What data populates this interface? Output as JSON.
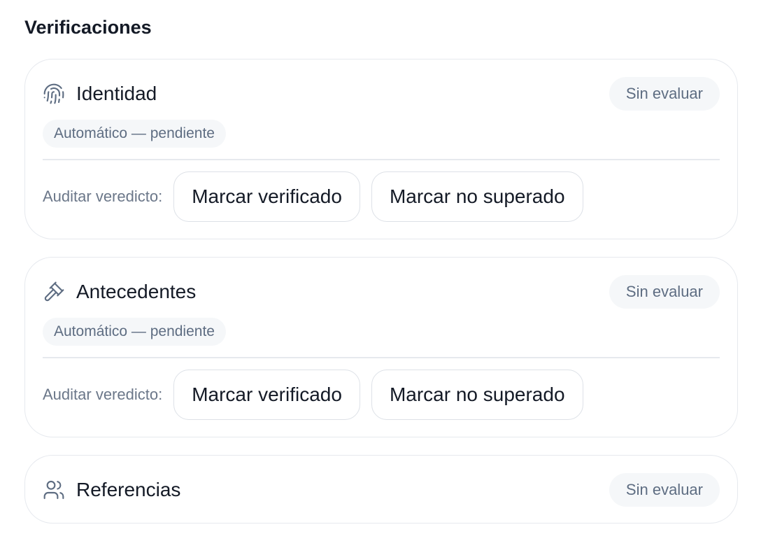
{
  "section": {
    "title": "Verificaciones"
  },
  "checks": [
    {
      "title": "Identidad",
      "icon": "fingerprint-icon",
      "status": "Sin evaluar",
      "method": "Automático — pendiente",
      "audit_label": "Auditar veredicto:",
      "verify_label": "Marcar verificado",
      "fail_label": "Marcar no superado"
    },
    {
      "title": "Antecedentes",
      "icon": "gavel-icon",
      "status": "Sin evaluar",
      "method": "Automático — pendiente",
      "audit_label": "Auditar veredicto:",
      "verify_label": "Marcar verificado",
      "fail_label": "Marcar no superado"
    },
    {
      "title": "Referencias",
      "icon": "users-icon",
      "status": "Sin evaluar"
    }
  ],
  "colors": {
    "title_text": "#141a26",
    "muted_text": "#5e6d82",
    "chip_bg": "#f5f7f9",
    "border": "#e6e9ee",
    "icon": "#5e6d82"
  }
}
